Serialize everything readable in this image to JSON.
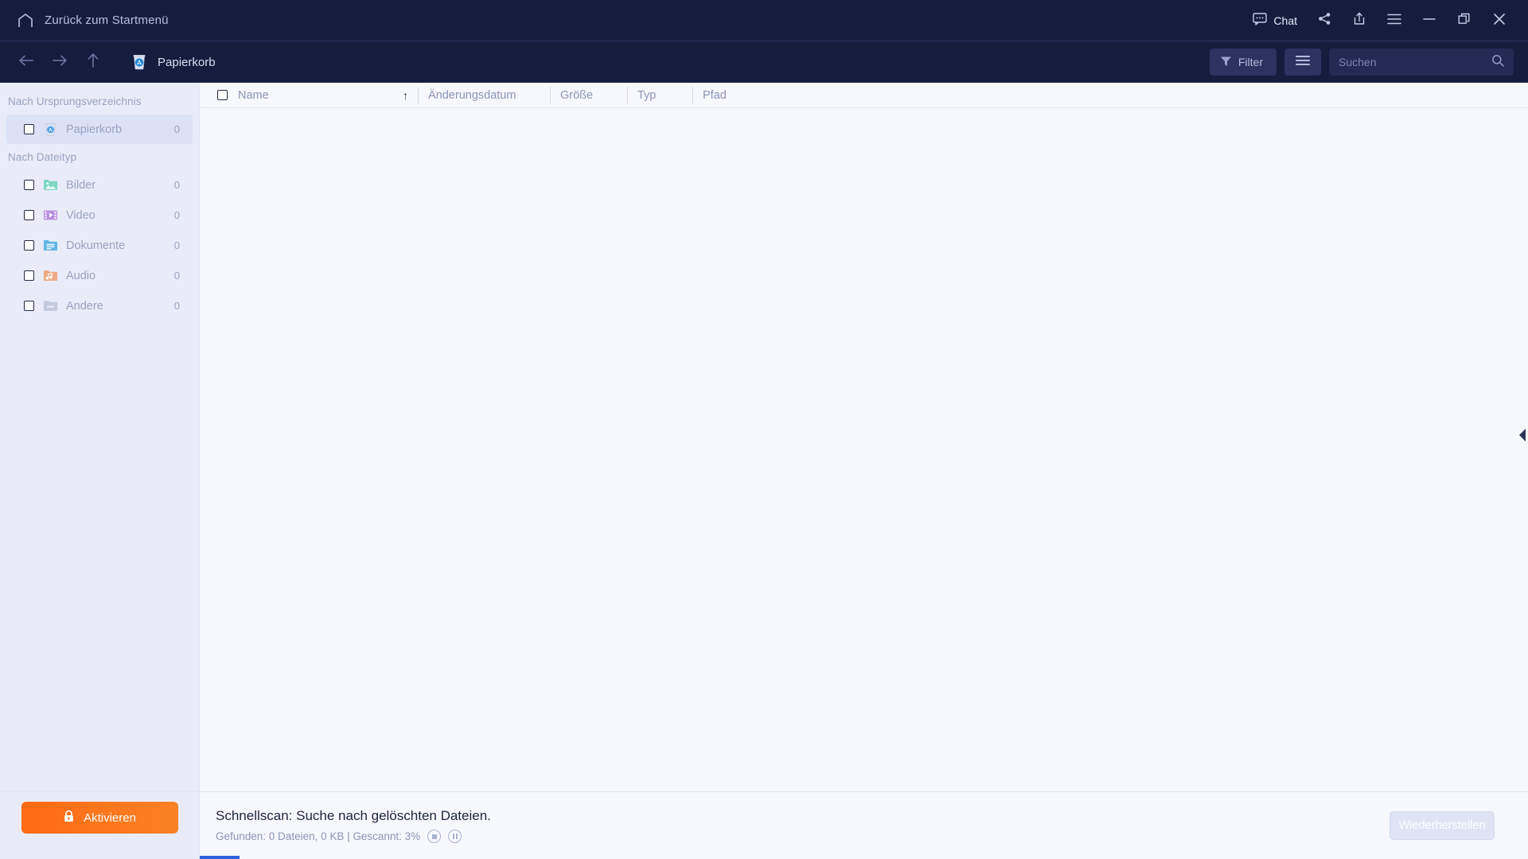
{
  "titlebar": {
    "home_label": "Zurück zum Startmenü",
    "home_icon": "home-icon",
    "chat_label": "Chat",
    "chat_icon": "chat-bubble-icon",
    "share_icon": "share-icon",
    "export_icon": "export-icon",
    "menu_icon": "hamburger-menu-icon",
    "minimize_icon": "minimize-icon",
    "maximize_icon": "maximize-restore-icon",
    "close_icon": "close-icon"
  },
  "navbar": {
    "back_icon": "arrow-left-icon",
    "forward_icon": "arrow-right-icon",
    "up_icon": "arrow-up-icon",
    "breadcrumb_label": "Papierkorb",
    "breadcrumb_icon": "recycle-bin-icon",
    "filter_label": "Filter",
    "filter_icon": "funnel-icon",
    "view_icon": "list-view-icon",
    "search_placeholder": "Suchen",
    "search_value": "",
    "search_icon": "search-icon"
  },
  "sidebar": {
    "groups": [
      {
        "title": "Nach Ursprungsverzeichnis",
        "items": [
          {
            "label": "Papierkorb",
            "count": "0",
            "icon": "recycle-bin-icon",
            "active": true
          }
        ]
      },
      {
        "title": "Nach Dateityp",
        "items": [
          {
            "label": "Bilder",
            "count": "0",
            "icon": "images-folder-icon",
            "active": false
          },
          {
            "label": "Video",
            "count": "0",
            "icon": "video-folder-icon",
            "active": false
          },
          {
            "label": "Dokumente",
            "count": "0",
            "icon": "documents-folder-icon",
            "active": false
          },
          {
            "label": "Audio",
            "count": "0",
            "icon": "audio-folder-icon",
            "active": false
          },
          {
            "label": "Andere",
            "count": "0",
            "icon": "other-folder-icon",
            "active": false
          }
        ]
      }
    ],
    "activate_label": "Aktivieren",
    "activate_icon": "lock-icon"
  },
  "table": {
    "columns": [
      {
        "label": "Name",
        "sorted": true,
        "sort_icon": "arrow-up-icon"
      },
      {
        "label": "Änderungsdatum"
      },
      {
        "label": "Größe"
      },
      {
        "label": "Typ"
      },
      {
        "label": "Pfad"
      }
    ],
    "rows": []
  },
  "statusbar": {
    "title": "Schnellscan: Suche nach gelöschten Dateien.",
    "subtitle": "Gefunden: 0 Dateien, 0 KB | Gescannt: 3%",
    "stop_icon": "stop-icon",
    "pause_icon": "pause-icon",
    "restore_label": "Wiederherstellen",
    "progress_percent": 3
  },
  "panel": {
    "collapse_icon": "triangle-left-icon"
  },
  "colors": {
    "header_bg": "#151d3f",
    "sidebar_bg": "#e9ecf8",
    "content_bg": "#f7f8fd",
    "accent_orange": "#ff6a13",
    "progress_blue": "#2b62e0",
    "selection_blue": "#dbe2f7"
  }
}
